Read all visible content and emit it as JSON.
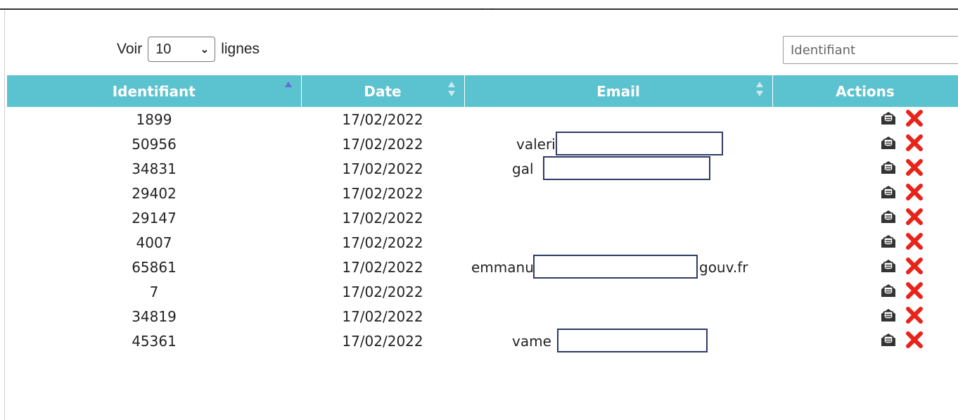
{
  "length_menu": {
    "prefix": "Voir",
    "value": "10",
    "suffix": "lignes"
  },
  "search": {
    "placeholder": "Identifiant"
  },
  "columns": [
    {
      "label": "Identifiant",
      "sort": "asc"
    },
    {
      "label": "Date",
      "sort": "both"
    },
    {
      "label": "Email",
      "sort": "both"
    },
    {
      "label": "Actions",
      "sort": "none"
    }
  ],
  "rows": [
    {
      "id": "1899",
      "date": "17/02/2022",
      "email": ""
    },
    {
      "id": "50956",
      "date": "17/02/2022",
      "email": "valeri"
    },
    {
      "id": "34831",
      "date": "17/02/2022",
      "email": "gal"
    },
    {
      "id": "29402",
      "date": "17/02/2022",
      "email": ""
    },
    {
      "id": "29147",
      "date": "17/02/2022",
      "email": ""
    },
    {
      "id": "4007",
      "date": "17/02/2022",
      "email": ""
    },
    {
      "id": "65861",
      "date": "17/02/2022",
      "email": "emmanu",
      "email_suffix": "gouv.fr"
    },
    {
      "id": "7",
      "date": "17/02/2022",
      "email": ""
    },
    {
      "id": "34819",
      "date": "17/02/2022",
      "email": ""
    },
    {
      "id": "45361",
      "date": "17/02/2022",
      "email": "vame"
    }
  ],
  "icons": {
    "view": "envelope-open-icon",
    "delete": "red-x-delete-icon"
  },
  "colors": {
    "header_bg": "#5bc2cf",
    "delete": "#e8231a",
    "sort_active": "#6a6bd6"
  }
}
